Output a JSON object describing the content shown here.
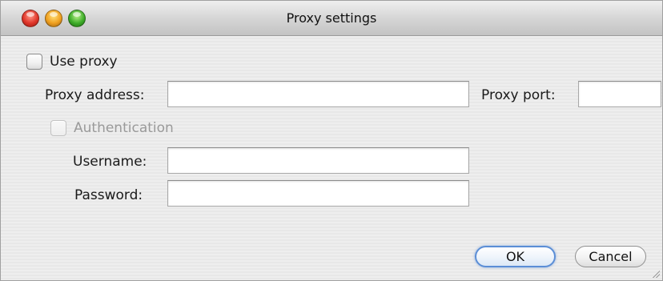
{
  "window": {
    "title": "Proxy settings"
  },
  "use_proxy": {
    "label": "Use proxy",
    "checked": false
  },
  "proxy_address": {
    "label": "Proxy address:",
    "value": ""
  },
  "proxy_port": {
    "label": "Proxy port:",
    "value": ""
  },
  "authentication": {
    "label": "Authentication",
    "checked": false,
    "enabled": false
  },
  "username": {
    "label": "Username:",
    "value": ""
  },
  "password": {
    "label": "Password:",
    "value": ""
  },
  "buttons": {
    "ok": "OK",
    "cancel": "Cancel"
  },
  "colors": {
    "default_button_border": "#5b8ed6",
    "disabled_text": "#9a9a9a",
    "close": "#e0362a",
    "minimize": "#f0a020",
    "zoom": "#3fae2a"
  },
  "icons": {
    "close": "close-traffic-light-icon",
    "minimize": "minimize-traffic-light-icon",
    "zoom": "zoom-traffic-light-icon",
    "resize": "resize-grip-icon"
  }
}
